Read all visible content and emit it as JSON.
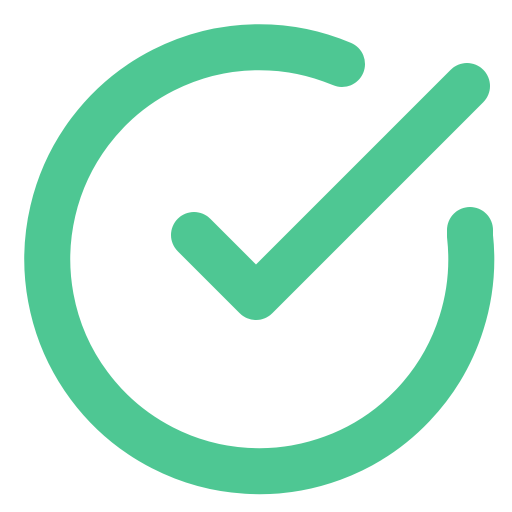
{
  "icon": {
    "name": "check-circle-icon",
    "color": "#4EC793",
    "background": "#FFFFFF"
  }
}
